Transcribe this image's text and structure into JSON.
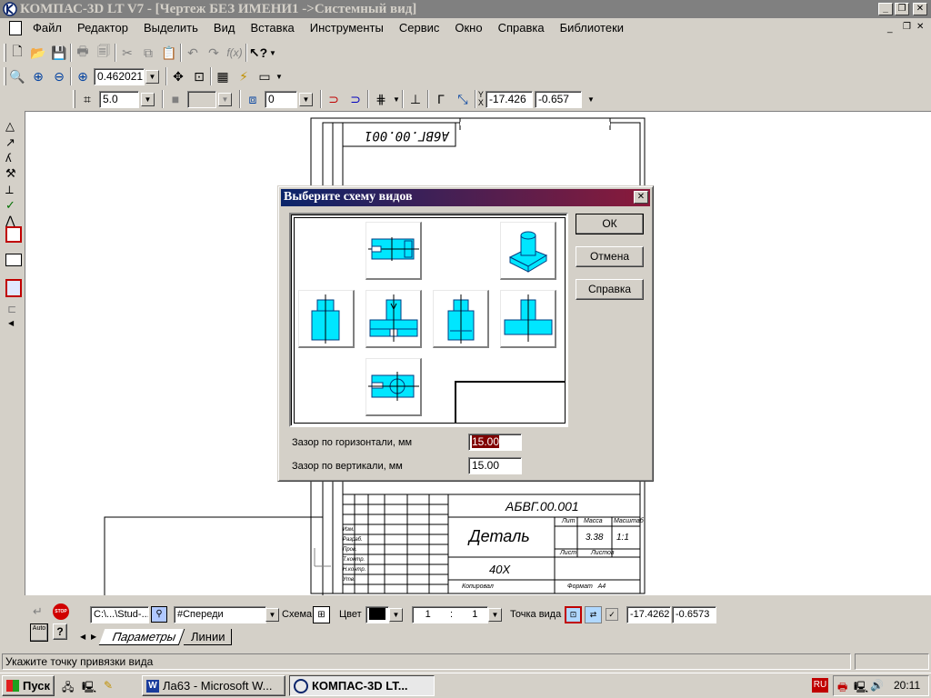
{
  "window": {
    "title": "КОМПАС-3D LT V7 - [Чертеж БЕЗ ИМЕНИ1 ->Системный вид]"
  },
  "menu": [
    "Файл",
    "Редактор",
    "Выделить",
    "Вид",
    "Вставка",
    "Инструменты",
    "Сервис",
    "Окно",
    "Справка",
    "Библиотеки"
  ],
  "toolbar_view": {
    "zoom_value": "0.462021"
  },
  "toolbar_state": {
    "step_value": "5.0",
    "layer_value": "0",
    "x_label": "X",
    "y_label": "Y",
    "x_value": "-17.426",
    "y_value": "-0.657"
  },
  "drawing": {
    "stamp_top": "А6ВГ.00.001",
    "designation": "АБВГ.00.001",
    "part_name": "Деталь",
    "material": "40Х",
    "mass": "3.38",
    "scale": "1:1",
    "format": "Формат   А4",
    "copied": "Копировал",
    "col_lit": "Лит",
    "col_mass": "Масса",
    "col_scale": "Масштаб",
    "col_sheet": "Лист",
    "col_sheets": "Листов",
    "rows": [
      "Изм.",
      "Разраб.",
      "Пров.",
      "Т.контр.",
      "Н.контр.",
      "Утв."
    ]
  },
  "dialog": {
    "title": "Выберите схему видов",
    "ok": "ОК",
    "cancel": "Отмена",
    "help": "Справка",
    "gap_h_label": "Зазор по горизонтали, мм",
    "gap_h_value": "15.00",
    "gap_v_label": "Зазор по вертикали, мм",
    "gap_v_value": "15.00"
  },
  "param_bar": {
    "path": "C:\\...\\Stud-...",
    "view_name": "#Спереди",
    "scheme_label": "Схема",
    "color_label": "Цвет",
    "scale_left": "1",
    "scale_sep": ":",
    "scale_right": "1",
    "view_point_label": "Точка вида",
    "x_value": "-17.4262",
    "y_value": "-0.6573",
    "tab_params": "Параметры",
    "tab_lines": "Линии",
    "auto_label": "Auto",
    "stop_label": "STOP"
  },
  "status": {
    "text": "Укажите точку привязки вида"
  },
  "taskbar": {
    "start": "Пуск",
    "task1": "Ла63 - Microsoft W...",
    "task2": "КОМПАС-3D LT...",
    "lang": "RU",
    "time": "20:11"
  },
  "colors": {
    "title_bar": "#0a246a",
    "title_bar_end": "#a6caf0",
    "dialog_title": "#0a246a",
    "dialog_title_end": "#8b1a3a",
    "selection": "#800000",
    "view_fill": "#00e6ff"
  }
}
